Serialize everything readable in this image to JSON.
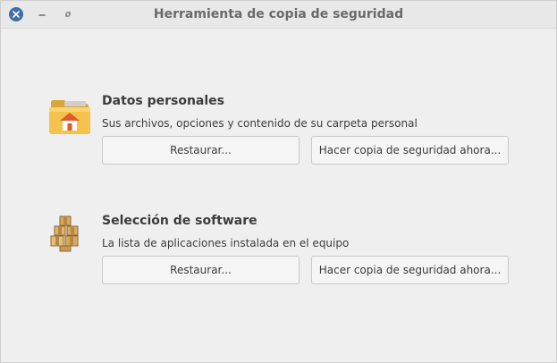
{
  "window": {
    "title": "Herramienta de copia de seguridad"
  },
  "sections": [
    {
      "icon": "home-folder-icon",
      "title": "Datos personales",
      "description": "Sus archivos, opciones y contenido de su carpeta personal",
      "restore_label": "Restaurar...",
      "backup_label": "Hacer copia de seguridad ahora..."
    },
    {
      "icon": "software-packages-icon",
      "title": "Selección de software",
      "description": "La lista de aplicaciones instalada en el equipo",
      "restore_label": "Restaurar...",
      "backup_label": "Hacer copia de seguridad ahora..."
    }
  ],
  "colors": {
    "close_button": "#3f6ea8",
    "folder": "#f5c24b",
    "house_roof": "#e05a2b"
  }
}
